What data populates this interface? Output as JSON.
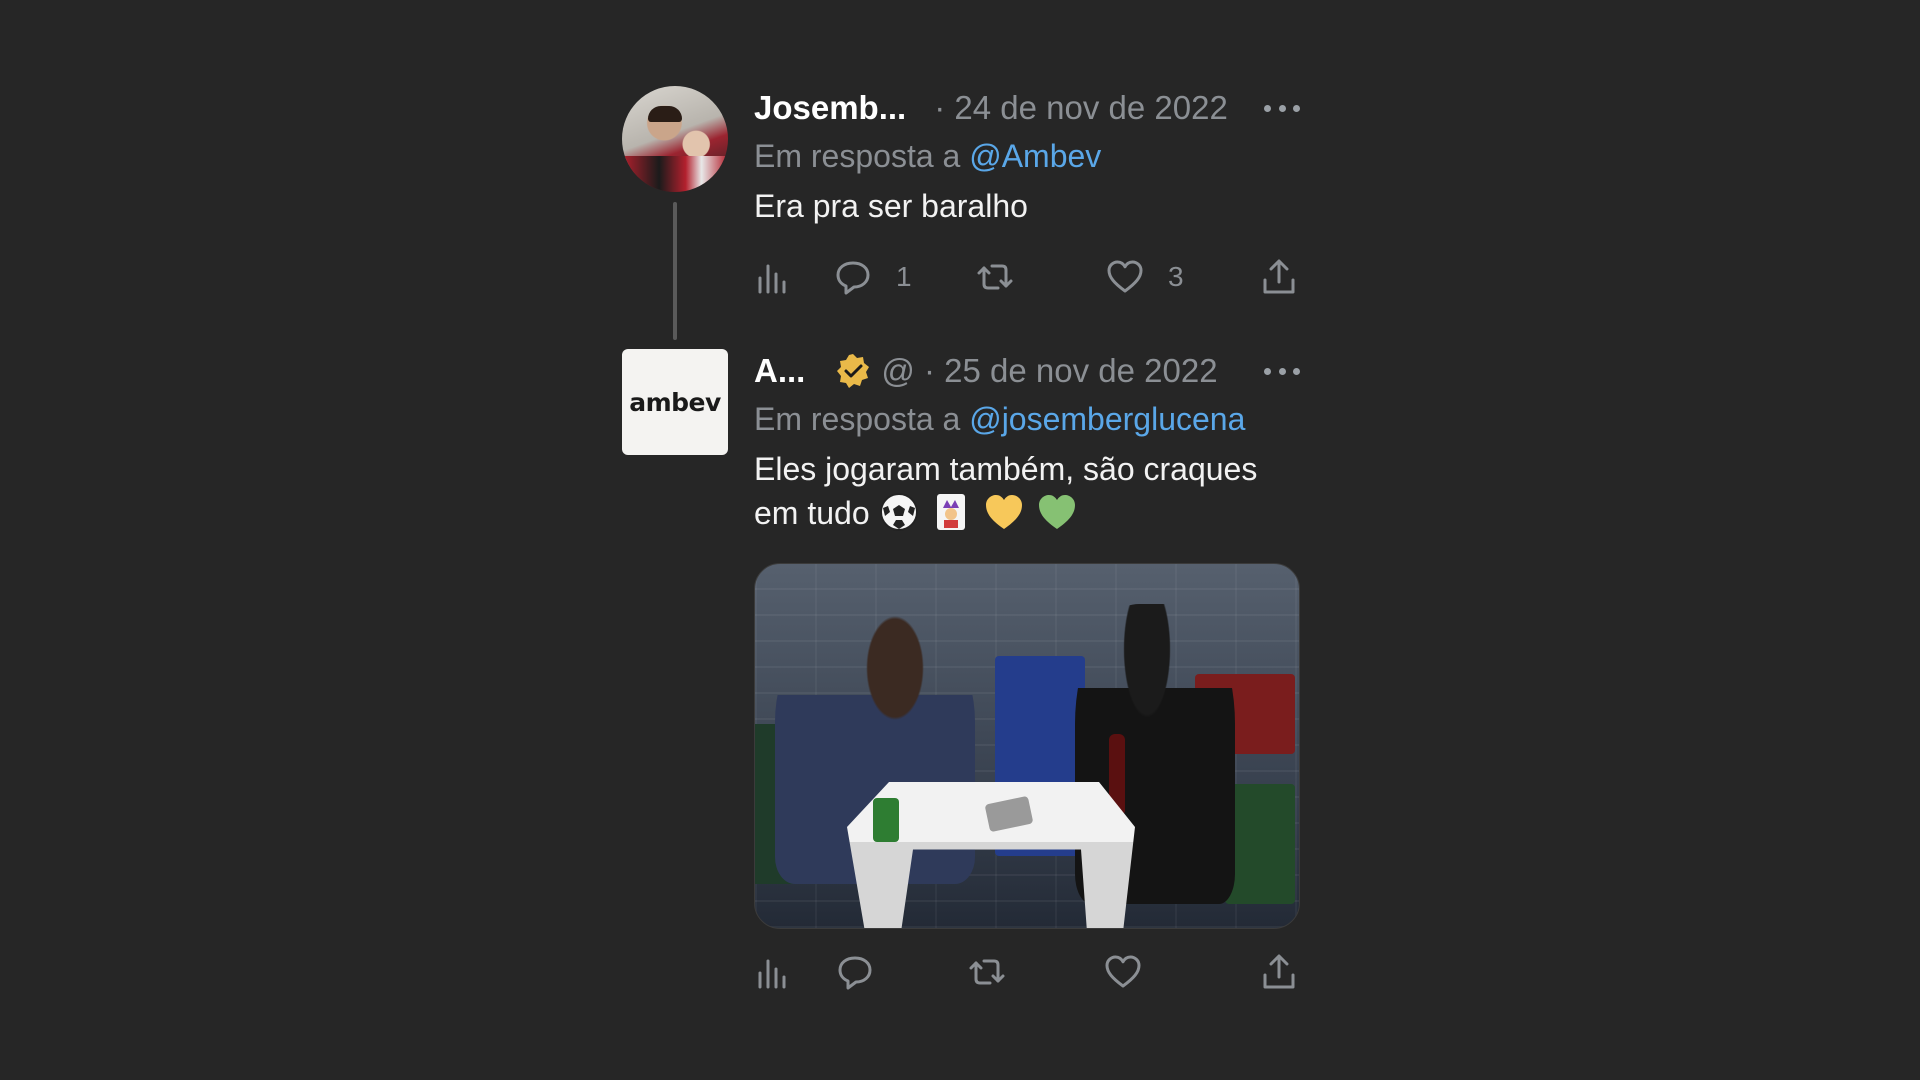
{
  "colors": {
    "background": "#262626",
    "text": "#f2f2f2",
    "muted": "#8b8f94",
    "link": "#5aa7e8",
    "verified_badge": "#e9b949"
  },
  "tweets": [
    {
      "author_name": "Josemb...",
      "date": "· 24 de nov de 2022",
      "reply_prefix": "Em resposta a",
      "reply_handle": "@Ambev",
      "text": "Era pra ser baralho",
      "emojis": [],
      "stats": {
        "views": "",
        "replies": "1",
        "retweets": "",
        "likes": "3"
      },
      "avatar_icon": "user-photo-avatar"
    },
    {
      "author_name": "A...",
      "verified": true,
      "handle_and_date": "@ · 25 de nov de 2022",
      "reply_prefix": "Em resposta a",
      "reply_handle": "@josemberglucena",
      "text": "Eles jogaram também, são craques em tudo",
      "emojis": [
        "soccer-ball-emoji",
        "joker-card-emoji",
        "yellow-heart-emoji",
        "green-heart-emoji"
      ],
      "brand_wordmark": "ambev",
      "has_media": true,
      "media_description_icon": "photo-two-men-playing-cards",
      "stats": {
        "views": "",
        "replies": "",
        "retweets": "",
        "likes": ""
      }
    }
  ],
  "icons": {
    "more": "more-horizontal-icon",
    "views": "analytics-icon",
    "reply": "reply-bubble-icon",
    "retweet": "retweet-icon",
    "like": "heart-icon",
    "share": "share-upload-icon"
  }
}
